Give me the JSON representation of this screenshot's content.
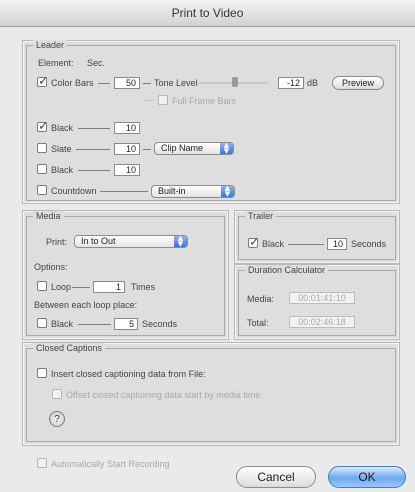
{
  "window": {
    "title": "Print to Video"
  },
  "leader": {
    "group_title": "Leader",
    "element_header": "Element:",
    "sec_header": "Sec.",
    "color_bars": {
      "label": "Color Bars",
      "checked": true,
      "sec": "50"
    },
    "tone": {
      "label": "Tone Level",
      "db_value": "-12",
      "db_unit": "dB",
      "preview_label": "Preview"
    },
    "full_frame": {
      "label": "Full Frame Bars",
      "checked": false,
      "enabled": false
    },
    "black": {
      "label": "Black",
      "checked": true,
      "sec": "10"
    },
    "slate": {
      "label": "Slate",
      "checked": false,
      "sec": "10",
      "source": "Clip Name"
    },
    "black2": {
      "label": "Black",
      "checked": false,
      "sec": "10"
    },
    "countdown": {
      "label": "Countdown",
      "checked": false,
      "value": "Built-in"
    }
  },
  "media": {
    "group_title": "Media",
    "print_label": "Print:",
    "print_value": "In to Out",
    "options_label": "Options:",
    "loop": {
      "label": "Loop",
      "checked": false,
      "times": "1",
      "times_label": "Times"
    },
    "between_label": "Between each loop place:",
    "black": {
      "label": "Black",
      "checked": false,
      "sec": "5",
      "unit": "Seconds"
    }
  },
  "trailer": {
    "group_title": "Trailer",
    "black": {
      "label": "Black",
      "checked": true,
      "sec": "10",
      "unit": "Seconds"
    }
  },
  "duration": {
    "group_title": "Duration Calculator",
    "media_label": "Media:",
    "media_value": "00:01:41:10",
    "total_label": "Total:",
    "total_value": "00:02:46:18"
  },
  "captions": {
    "group_title": "Closed Captions",
    "insert": {
      "label": "Insert closed captioning data from File:",
      "checked": false
    },
    "offset": {
      "label": "Offset closed captioning data start by media time",
      "checked": false,
      "enabled": false
    },
    "help_glyph": "?"
  },
  "footer": {
    "auto_start": {
      "label": "Automatically Start Recording",
      "checked": false,
      "enabled": false
    },
    "cancel_label": "Cancel",
    "ok_label": "OK"
  }
}
